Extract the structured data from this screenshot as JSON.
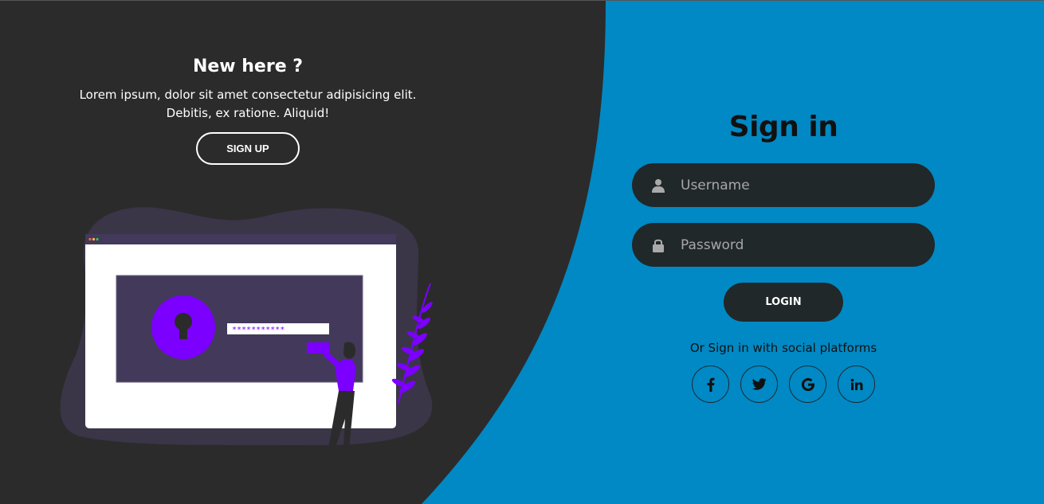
{
  "left": {
    "title": "New here ?",
    "line1": "Lorem ipsum, dolor sit amet consectetur adipisicing elit.",
    "line2": "Debitis, ex ratione. Aliquid!",
    "signup_label": "SIGN UP"
  },
  "illustration": {
    "password_mask": "***********"
  },
  "signin": {
    "title": "Sign in",
    "username_placeholder": "Username",
    "password_placeholder": "Password",
    "login_label": "LOGIN",
    "social_text": "Or Sign in with social platforms"
  },
  "social": [
    {
      "icon": "facebook-icon",
      "glyph": "f"
    },
    {
      "icon": "twitter-icon",
      "glyph": "🐦"
    },
    {
      "icon": "google-icon",
      "glyph": "G"
    },
    {
      "icon": "linkedin-icon",
      "glyph": "in"
    }
  ],
  "colors": {
    "dark": "#2b2b2b",
    "accent": "#0089c4",
    "purple": "#7b00ff",
    "input_bg": "#21282a"
  }
}
